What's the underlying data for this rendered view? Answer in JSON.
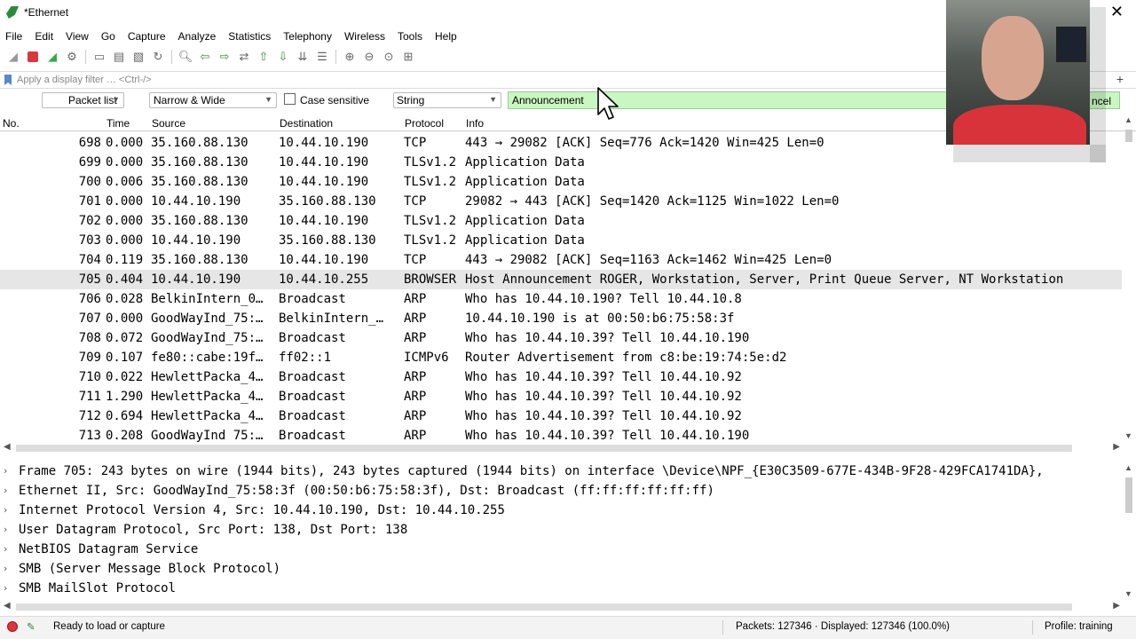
{
  "window": {
    "title": "*Ethernet"
  },
  "menu": [
    "File",
    "Edit",
    "View",
    "Go",
    "Capture",
    "Analyze",
    "Statistics",
    "Telephony",
    "Wireless",
    "Tools",
    "Help"
  ],
  "display_filter": {
    "placeholder": "Apply a display filter … <Ctrl-/>"
  },
  "search": {
    "scope": "Packet list",
    "charset": "Narrow & Wide",
    "case_sensitive_label": "Case sensitive",
    "type": "String",
    "value": "Announcement",
    "cancel_label": "ncel"
  },
  "columns": {
    "no": "No.",
    "time": "Time",
    "source": "Source",
    "destination": "Destination",
    "protocol": "Protocol",
    "info": "Info"
  },
  "packets": [
    {
      "no": "698",
      "time": "0.000",
      "src": "35.160.88.130",
      "dst": "10.44.10.190",
      "proto": "TCP",
      "info": "443 → 29082 [ACK] Seq=776 Ack=1420 Win=425 Len=0"
    },
    {
      "no": "699",
      "time": "0.000",
      "src": "35.160.88.130",
      "dst": "10.44.10.190",
      "proto": "TLSv1.2",
      "info": "Application Data"
    },
    {
      "no": "700",
      "time": "0.006",
      "src": "35.160.88.130",
      "dst": "10.44.10.190",
      "proto": "TLSv1.2",
      "info": "Application Data"
    },
    {
      "no": "701",
      "time": "0.000",
      "src": "10.44.10.190",
      "dst": "35.160.88.130",
      "proto": "TCP",
      "info": "29082 → 443 [ACK] Seq=1420 Ack=1125 Win=1022 Len=0"
    },
    {
      "no": "702",
      "time": "0.000",
      "src": "35.160.88.130",
      "dst": "10.44.10.190",
      "proto": "TLSv1.2",
      "info": "Application Data"
    },
    {
      "no": "703",
      "time": "0.000",
      "src": "10.44.10.190",
      "dst": "35.160.88.130",
      "proto": "TLSv1.2",
      "info": "Application Data"
    },
    {
      "no": "704",
      "time": "0.119",
      "src": "35.160.88.130",
      "dst": "10.44.10.190",
      "proto": "TCP",
      "info": "443 → 29082 [ACK] Seq=1163 Ack=1462 Win=425 Len=0"
    },
    {
      "no": "705",
      "time": "0.404",
      "src": "10.44.10.190",
      "dst": "10.44.10.255",
      "proto": "BROWSER",
      "info": "Host Announcement ROGER, Workstation, Server, Print Queue Server, NT Workstation"
    },
    {
      "no": "706",
      "time": "0.028",
      "src": "BelkinIntern_0…",
      "dst": "Broadcast",
      "proto": "ARP",
      "info": "Who has 10.44.10.190? Tell 10.44.10.8"
    },
    {
      "no": "707",
      "time": "0.000",
      "src": "GoodWayInd_75:…",
      "dst": "BelkinIntern_…",
      "proto": "ARP",
      "info": "10.44.10.190 is at 00:50:b6:75:58:3f"
    },
    {
      "no": "708",
      "time": "0.072",
      "src": "GoodWayInd_75:…",
      "dst": "Broadcast",
      "proto": "ARP",
      "info": "Who has 10.44.10.39? Tell 10.44.10.190"
    },
    {
      "no": "709",
      "time": "0.107",
      "src": "fe80::cabe:19f…",
      "dst": "ff02::1",
      "proto": "ICMPv6",
      "info": "Router Advertisement from c8:be:19:74:5e:d2"
    },
    {
      "no": "710",
      "time": "0.022",
      "src": "HewlettPacka_4…",
      "dst": "Broadcast",
      "proto": "ARP",
      "info": "Who has 10.44.10.39? Tell 10.44.10.92"
    },
    {
      "no": "711",
      "time": "1.290",
      "src": "HewlettPacka_4…",
      "dst": "Broadcast",
      "proto": "ARP",
      "info": "Who has 10.44.10.39? Tell 10.44.10.92"
    },
    {
      "no": "712",
      "time": "0.694",
      "src": "HewlettPacka_4…",
      "dst": "Broadcast",
      "proto": "ARP",
      "info": "Who has 10.44.10.39? Tell 10.44.10.92"
    },
    {
      "no": "713",
      "time": "0.208",
      "src": "GoodWayInd_75:…",
      "dst": "Broadcast",
      "proto": "ARP",
      "info": "Who has 10.44.10.39? Tell 10.44.10.190"
    }
  ],
  "details": [
    "Frame 705: 243 bytes on wire (1944 bits), 243 bytes captured (1944 bits) on interface \\Device\\NPF_{E30C3509-677E-434B-9F28-429FCA1741DA},",
    "Ethernet II, Src: GoodWayInd_75:58:3f (00:50:b6:75:58:3f), Dst: Broadcast (ff:ff:ff:ff:ff:ff)",
    "Internet Protocol Version 4, Src: 10.44.10.190, Dst: 10.44.10.255",
    "User Datagram Protocol, Src Port: 138, Dst Port: 138",
    "NetBIOS Datagram Service",
    "SMB (Server Message Block Protocol)",
    "SMB MailSlot Protocol"
  ],
  "status": {
    "ready": "Ready to load or capture",
    "packets": "Packets: 127346 · Displayed: 127346 (100.0%)",
    "profile": "Profile: training"
  },
  "colors": {
    "search_bg": "#c9f7c1",
    "selected_row": "#e6e6e6",
    "capture_stop": "#d9363e"
  }
}
